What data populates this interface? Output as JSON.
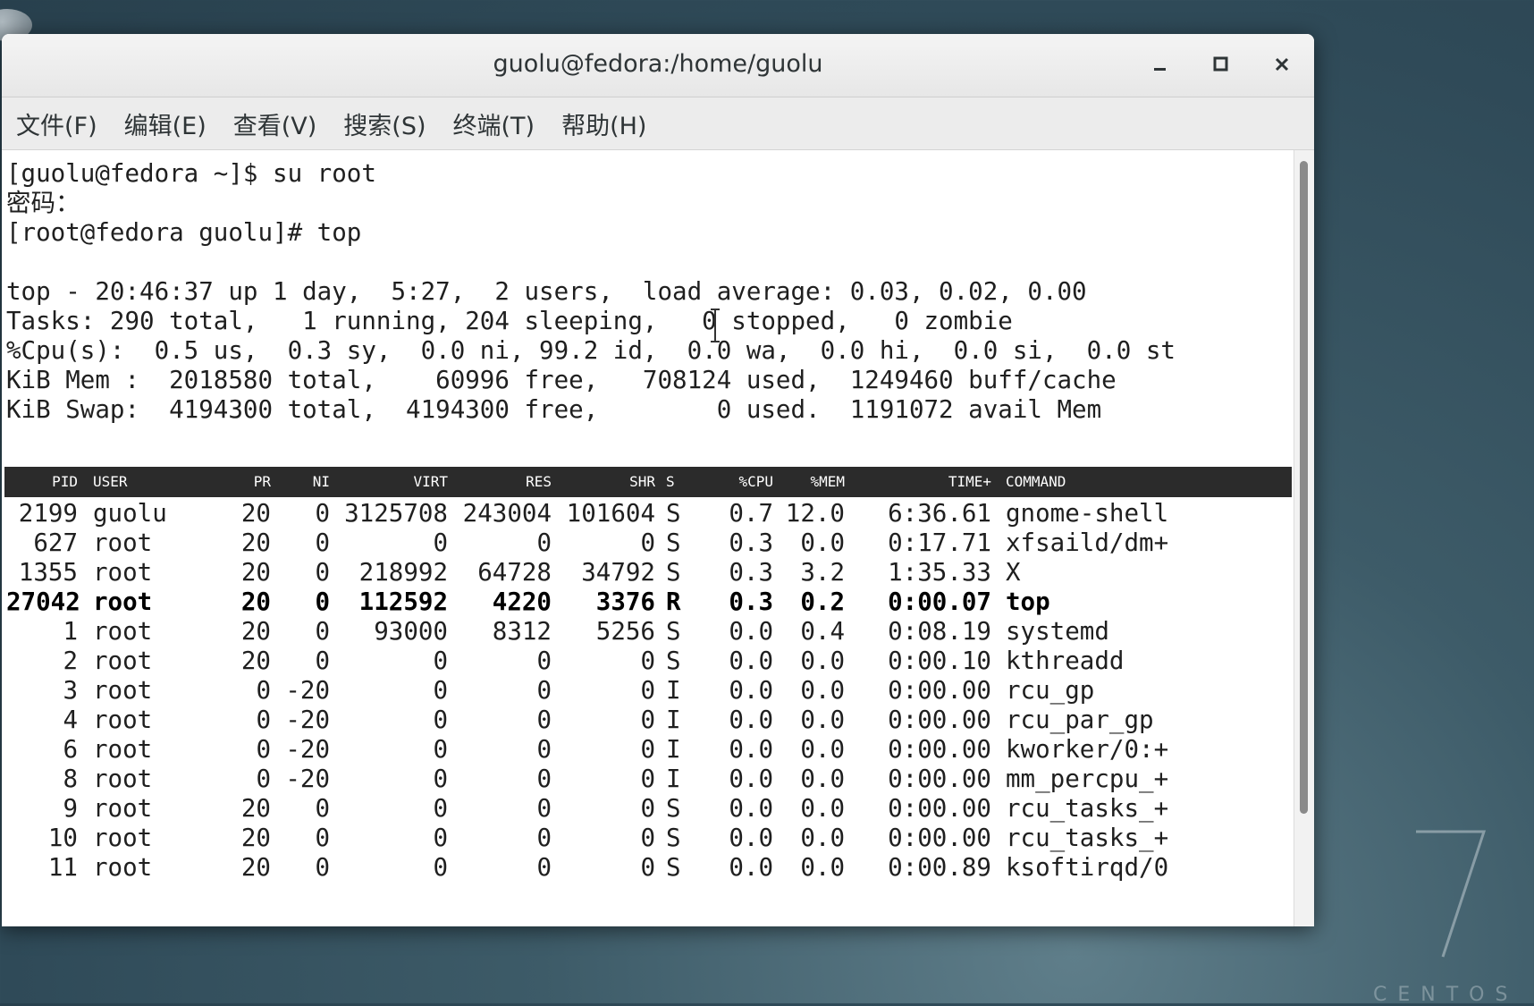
{
  "window": {
    "title": "guolu@fedora:/home/guolu"
  },
  "menu": [
    "文件(F)",
    "编辑(E)",
    "查看(V)",
    "搜索(S)",
    "终端(T)",
    "帮助(H)"
  ],
  "desktop": {
    "brand_text": "CENTOS",
    "brand_number": "7"
  },
  "terminal": {
    "lines": [
      "[guolu@fedora ~]$ su root",
      "密码：",
      "[root@fedora guolu]# top"
    ],
    "summary": [
      "top - 20:46:37 up 1 day,  5:27,  2 users,  load average: 0.03, 0.02, 0.00",
      "Tasks: 290 total,   1 running, 204 sleeping,   0 stopped,   0 zombie",
      "%Cpu(s):  0.5 us,  0.3 sy,  0.0 ni, 99.2 id,  0.0 wa,  0.0 hi,  0.0 si,  0.0 st",
      "KiB Mem :  2018580 total,    60996 free,   708124 used,  1249460 buff/cache",
      "KiB Swap:  4194300 total,  4194300 free,        0 used.  1191072 avail Mem"
    ],
    "columns": [
      "PID",
      "USER",
      "PR",
      "NI",
      "VIRT",
      "RES",
      "SHR",
      "S",
      "%CPU",
      "%MEM",
      "TIME+",
      "COMMAND"
    ],
    "processes": [
      {
        "pid": "2199",
        "user": "guolu",
        "pr": "20",
        "ni": "0",
        "virt": "3125708",
        "res": "243004",
        "shr": "101604",
        "s": "S",
        "cpu": "0.7",
        "mem": "12.0",
        "time": "6:36.61",
        "cmd": "gnome-shell"
      },
      {
        "pid": "627",
        "user": "root",
        "pr": "20",
        "ni": "0",
        "virt": "0",
        "res": "0",
        "shr": "0",
        "s": "S",
        "cpu": "0.3",
        "mem": "0.0",
        "time": "0:17.71",
        "cmd": "xfsaild/dm+"
      },
      {
        "pid": "1355",
        "user": "root",
        "pr": "20",
        "ni": "0",
        "virt": "218992",
        "res": "64728",
        "shr": "34792",
        "s": "S",
        "cpu": "0.3",
        "mem": "3.2",
        "time": "1:35.33",
        "cmd": "X"
      },
      {
        "pid": "27042",
        "user": "root",
        "pr": "20",
        "ni": "0",
        "virt": "112592",
        "res": "4220",
        "shr": "3376",
        "s": "R",
        "cpu": "0.3",
        "mem": "0.2",
        "time": "0:00.07",
        "cmd": "top",
        "bold": true
      },
      {
        "pid": "1",
        "user": "root",
        "pr": "20",
        "ni": "0",
        "virt": "93000",
        "res": "8312",
        "shr": "5256",
        "s": "S",
        "cpu": "0.0",
        "mem": "0.4",
        "time": "0:08.19",
        "cmd": "systemd"
      },
      {
        "pid": "2",
        "user": "root",
        "pr": "20",
        "ni": "0",
        "virt": "0",
        "res": "0",
        "shr": "0",
        "s": "S",
        "cpu": "0.0",
        "mem": "0.0",
        "time": "0:00.10",
        "cmd": "kthreadd"
      },
      {
        "pid": "3",
        "user": "root",
        "pr": "0",
        "ni": "-20",
        "virt": "0",
        "res": "0",
        "shr": "0",
        "s": "I",
        "cpu": "0.0",
        "mem": "0.0",
        "time": "0:00.00",
        "cmd": "rcu_gp"
      },
      {
        "pid": "4",
        "user": "root",
        "pr": "0",
        "ni": "-20",
        "virt": "0",
        "res": "0",
        "shr": "0",
        "s": "I",
        "cpu": "0.0",
        "mem": "0.0",
        "time": "0:00.00",
        "cmd": "rcu_par_gp"
      },
      {
        "pid": "6",
        "user": "root",
        "pr": "0",
        "ni": "-20",
        "virt": "0",
        "res": "0",
        "shr": "0",
        "s": "I",
        "cpu": "0.0",
        "mem": "0.0",
        "time": "0:00.00",
        "cmd": "kworker/0:+"
      },
      {
        "pid": "8",
        "user": "root",
        "pr": "0",
        "ni": "-20",
        "virt": "0",
        "res": "0",
        "shr": "0",
        "s": "I",
        "cpu": "0.0",
        "mem": "0.0",
        "time": "0:00.00",
        "cmd": "mm_percpu_+"
      },
      {
        "pid": "9",
        "user": "root",
        "pr": "20",
        "ni": "0",
        "virt": "0",
        "res": "0",
        "shr": "0",
        "s": "S",
        "cpu": "0.0",
        "mem": "0.0",
        "time": "0:00.00",
        "cmd": "rcu_tasks_+"
      },
      {
        "pid": "10",
        "user": "root",
        "pr": "20",
        "ni": "0",
        "virt": "0",
        "res": "0",
        "shr": "0",
        "s": "S",
        "cpu": "0.0",
        "mem": "0.0",
        "time": "0:00.00",
        "cmd": "rcu_tasks_+"
      },
      {
        "pid": "11",
        "user": "root",
        "pr": "20",
        "ni": "0",
        "virt": "0",
        "res": "0",
        "shr": "0",
        "s": "S",
        "cpu": "0.0",
        "mem": "0.0",
        "time": "0:00.89",
        "cmd": "ksoftirqd/0"
      }
    ]
  }
}
